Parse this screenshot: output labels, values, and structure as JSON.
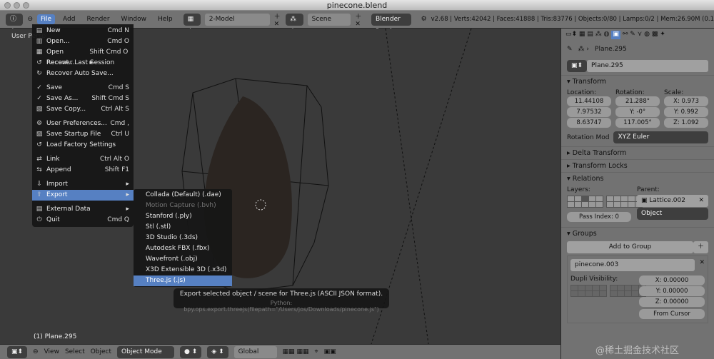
{
  "window": {
    "title": "pinecone.blend"
  },
  "info_header": {
    "menus": [
      "File",
      "Add",
      "Render",
      "Window",
      "Help"
    ],
    "active_menu": "File",
    "screen": "2-Model",
    "scene": "Scene",
    "engine": "Blender Render",
    "stats": "v2.68 | Verts:42042 | Faces:41888 | Tris:83776 | Objects:0/80 | Lamps:0/2 | Mem:26.90M (0.1"
  },
  "viewport": {
    "view_label": "User Persp",
    "object_label": "(1) Plane.295"
  },
  "file_menu": [
    {
      "label": "New",
      "shortcut": "Cmd N",
      "icon": "▤"
    },
    {
      "label": "Open...",
      "shortcut": "Cmd O",
      "icon": "▥"
    },
    {
      "label": "Open Recent...",
      "shortcut": "Shift Cmd O ▸",
      "icon": "▦"
    },
    {
      "label": "Recover Last Session",
      "shortcut": "",
      "icon": "↺"
    },
    {
      "label": "Recover Auto Save...",
      "shortcut": "",
      "icon": "↻",
      "sep_after": true
    },
    {
      "label": "Save",
      "shortcut": "Cmd S",
      "icon": "✓"
    },
    {
      "label": "Save As...",
      "shortcut": "Shift Cmd S",
      "icon": "✓"
    },
    {
      "label": "Save Copy...",
      "shortcut": "Ctrl Alt S",
      "icon": "▧",
      "sep_after": true
    },
    {
      "label": "User Preferences...",
      "shortcut": "Cmd ,",
      "icon": "⚙"
    },
    {
      "label": "Save Startup File",
      "shortcut": "Ctrl U",
      "icon": "▨"
    },
    {
      "label": "Load Factory Settings",
      "shortcut": "",
      "icon": "↺",
      "sep_after": true
    },
    {
      "label": "Link",
      "shortcut": "Ctrl Alt O",
      "icon": "⇄"
    },
    {
      "label": "Append",
      "shortcut": "Shift F1",
      "icon": "⇆",
      "sep_after": true
    },
    {
      "label": "Import",
      "shortcut": "▸",
      "icon": "⇩"
    },
    {
      "label": "Export",
      "shortcut": "▸",
      "icon": "⇧",
      "selected": true,
      "sep_after": true
    },
    {
      "label": "External Data",
      "shortcut": "▸",
      "icon": "▤"
    },
    {
      "label": "Quit",
      "shortcut": "Cmd Q",
      "icon": "⏻"
    }
  ],
  "export_menu": [
    {
      "label": "Collada (Default) (.dae)"
    },
    {
      "label": "Motion Capture (.bvh)",
      "disabled": true
    },
    {
      "label": "Stanford (.ply)"
    },
    {
      "label": "Stl (.stl)"
    },
    {
      "label": "3D Studio (.3ds)"
    },
    {
      "label": "Autodesk FBX (.fbx)"
    },
    {
      "label": "Wavefront (.obj)"
    },
    {
      "label": "X3D Extensible 3D (.x3d)"
    },
    {
      "label": "Three.js (.js)",
      "selected": true
    }
  ],
  "tooltip": {
    "text": "Export selected object / scene for Three.js (ASCII JSON format).",
    "python": "Python: bpy.ops.export.threejs(filepath=\"/Users/jos/Downloads/pinecone.js\")"
  },
  "properties": {
    "breadcrumb": "Plane.295",
    "object_name": "Plane.295",
    "transform": {
      "title": "Transform",
      "location_label": "Location:",
      "rotation_label": "Rotation:",
      "scale_label": "Scale:",
      "location": [
        "11.44108",
        "7.97532",
        "8.63747"
      ],
      "rotation": [
        "21.288°",
        "Y: -0°",
        "117.005°"
      ],
      "scale": [
        "X: 0.973",
        "Y: 0.992",
        "Z: 1.092"
      ],
      "rotation_mode_label": "Rotation Mod",
      "rotation_mode": "XYZ Euler"
    },
    "delta_transform": "Delta Transform",
    "transform_locks": "Transform Locks",
    "relations": {
      "title": "Relations",
      "layers_label": "Layers:",
      "parent_label": "Parent:",
      "parent": "Lattice.002",
      "parent_type": "Object",
      "pass_index": "Pass Index: 0"
    },
    "groups": {
      "title": "Groups",
      "add_button": "Add to Group",
      "group_name": "pinecone.003",
      "dupli_label": "Dupli Visibility:",
      "offset": [
        "X: 0.00000",
        "Y: 0.00000",
        "Z: 0.00000"
      ],
      "from_cursor": "From Cursor"
    }
  },
  "bottom_header": {
    "menus": [
      "View",
      "Select",
      "Object"
    ],
    "mode": "Object Mode",
    "orientation": "Global"
  },
  "watermark": "@稀土掘金技术社区",
  "colors": {
    "accent": "#5680c2"
  }
}
